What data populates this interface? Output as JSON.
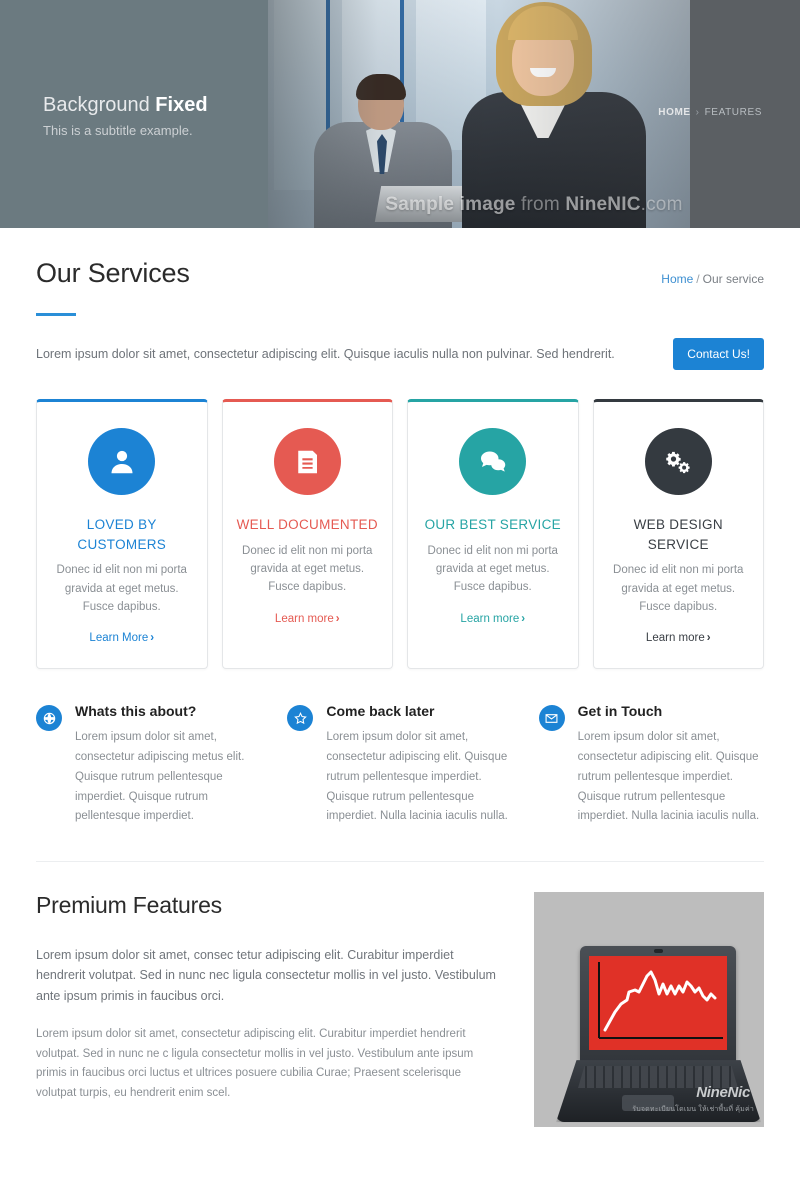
{
  "hero": {
    "title_normal": "Background ",
    "title_bold": "Fixed",
    "subtitle": "This is a subtitle example.",
    "watermark_pre": "Sample image ",
    "watermark_mid": "from ",
    "watermark_bold": "NineNIC",
    "watermark_post": ".com",
    "breadcrumb_home": "HOME",
    "breadcrumb_sep": "›",
    "breadcrumb_current": "FEATURES"
  },
  "services_header": {
    "page_title": "Our Services",
    "crumb_home": "Home",
    "crumb_sep": "/",
    "crumb_current": "Our service",
    "intro": "Lorem ipsum dolor sit amet, consectetur adipiscing elit. Quisque iaculis nulla non pulvinar. Sed hendrerit.",
    "contact_button": "Contact Us!",
    "accent_color": "#2a8fd8"
  },
  "cards": [
    {
      "title": "LOVED BY CUSTOMERS",
      "desc": "Donec id elit non mi porta gravida at eget metus. Fusce dapibus.",
      "link": "Learn More",
      "chevron": "›",
      "icon": "user-icon",
      "color": "#1c83d4"
    },
    {
      "title": "WELL DOCUMENTED",
      "desc": "Donec id elit non mi porta gravida at eget metus. Fusce dapibus.",
      "link": "Learn more",
      "chevron": "›",
      "icon": "document-icon",
      "color": "#e55a52"
    },
    {
      "title": "OUR BEST SERVICE",
      "desc": "Donec id elit non mi porta gravida at eget metus. Fusce dapibus.",
      "link": "Learn more",
      "chevron": "›",
      "icon": "chat-bubbles-icon",
      "color": "#26a4a4"
    },
    {
      "title": "WEB DESIGN SERVICE",
      "desc": "Donec id elit non mi porta gravida at eget metus. Fusce dapibus.",
      "link": "Learn more",
      "chevron": "›",
      "icon": "gears-icon",
      "color": "#343a40"
    }
  ],
  "features": [
    {
      "heading": "Whats this about?",
      "body": "Lorem ipsum dolor sit amet, consectetur adipiscing metus elit. Quisque rutrum pellentesque imperdiet. Quisque rutrum pellentesque imperdiet.",
      "icon": "globe-icon"
    },
    {
      "heading": "Come back later",
      "body": "Lorem ipsum dolor sit amet, consectetur adipiscing elit. Quisque rutrum pellentesque imperdiet. Quisque rutrum pellentesque imperdiet. Nulla lacinia iaculis nulla.",
      "icon": "star-icon"
    },
    {
      "heading": "Get in Touch",
      "body": "Lorem ipsum dolor sit amet, consectetur adipiscing elit. Quisque rutrum pellentesque imperdiet. Quisque rutrum pellentesque imperdiet. Nulla lacinia iaculis nulla.",
      "icon": "envelope-icon"
    }
  ],
  "premium": {
    "title": "Premium Features",
    "paragraph1": "Lorem ipsum dolor sit amet, consec tetur adipiscing elit. Curabitur imperdiet hendrerit volutpat. Sed in nunc nec ligula consectetur mollis in vel justo. Vestibulum ante ipsum primis in faucibus orci.",
    "paragraph2": "Lorem ipsum dolor sit amet, consectetur adipiscing elit. Curabitur imperdiet hendrerit volutpat. Sed in nunc ne c ligula consectetur mollis in vel justo. Vestibulum ante ipsum primis in faucibus orci luctus et ultrices posuere cubilia Curae; Praesent scelerisque volutpat turpis, eu hendrerit enim scel.",
    "image_brand": "NineNic",
    "image_brand_sub": "รับจดทะเบียนโดเมน ให้เช่าพื้นที่ คุ้มค่า"
  }
}
